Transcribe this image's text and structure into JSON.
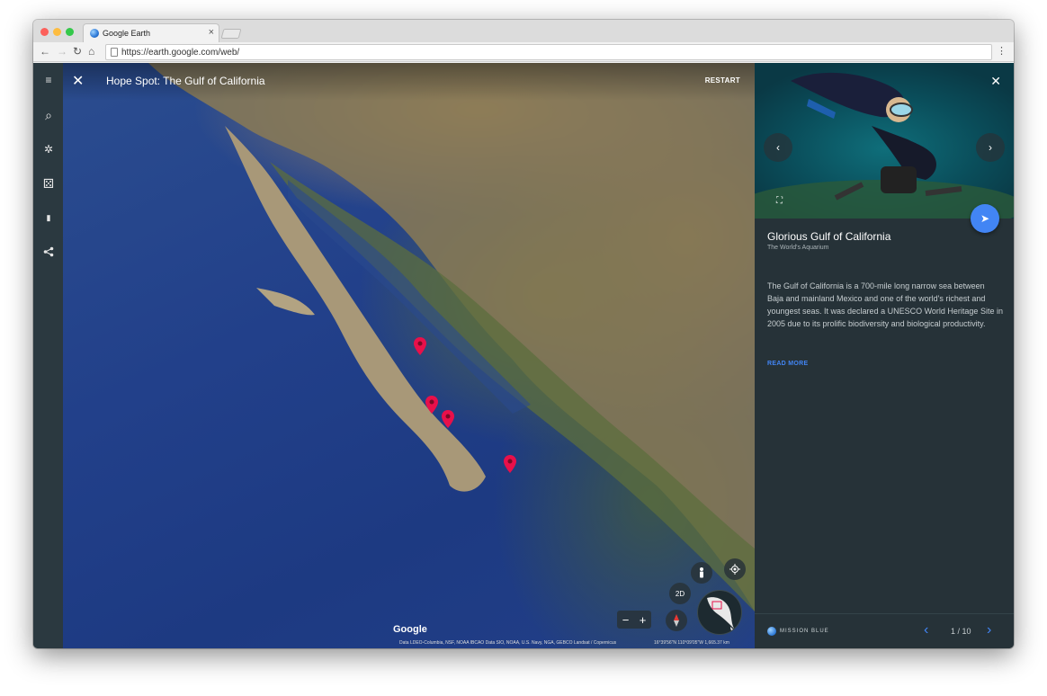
{
  "browser": {
    "tab_title": "Google Earth",
    "tab_close": "×",
    "url": "https://earth.google.com/web/",
    "back": "←",
    "forward": "→",
    "reload": "↻",
    "home": "⌂",
    "menu": "⋮"
  },
  "rail": {
    "items": [
      {
        "icon": "menu-icon",
        "glyph": "≡"
      },
      {
        "icon": "search-icon",
        "glyph": "⌕"
      },
      {
        "icon": "voyager-icon",
        "glyph": "✲"
      },
      {
        "icon": "dice-icon",
        "glyph": "⚄"
      },
      {
        "icon": "bookmark-icon",
        "glyph": "▮"
      },
      {
        "icon": "share-icon",
        "glyph": "<"
      }
    ]
  },
  "map": {
    "close": "✕",
    "title": "Hope Spot: The Gulf of California",
    "restart_label": "RESTART",
    "pin_color": "#e8104a",
    "two_d_label": "2D",
    "zoom_out": "−",
    "zoom_in": "+",
    "google_logo": "Google",
    "attribution": "Data LDEO-Columbia, NSF, NOAA   IBCAO   Data SIO, NOAA, U.S. Navy, NGA, GEBCO   Landsat / Copernicus",
    "coords": "16°39'56\"N 110°09'05\"W   1,665.37 km"
  },
  "panel": {
    "close": "✕",
    "prev_arrow": "‹",
    "next_arrow": "›",
    "fullscreen": "⛶",
    "share_fab": "➤",
    "title": "Glorious Gulf of California",
    "subtitle": "The World's Aquarium",
    "body": "The Gulf of California is a 700-mile long narrow sea between Baja and mainland Mexico and one of the world's richest and youngest seas. It was declared a UNESCO World Heritage Site in 2005 due to its prolific biodiversity and biological productivity.",
    "read_more": "READ MORE",
    "footer": {
      "brand": "MISSION BLUE",
      "prev": "‹",
      "count": "1 / 10",
      "next": "›"
    },
    "accent": "#4285f4"
  }
}
